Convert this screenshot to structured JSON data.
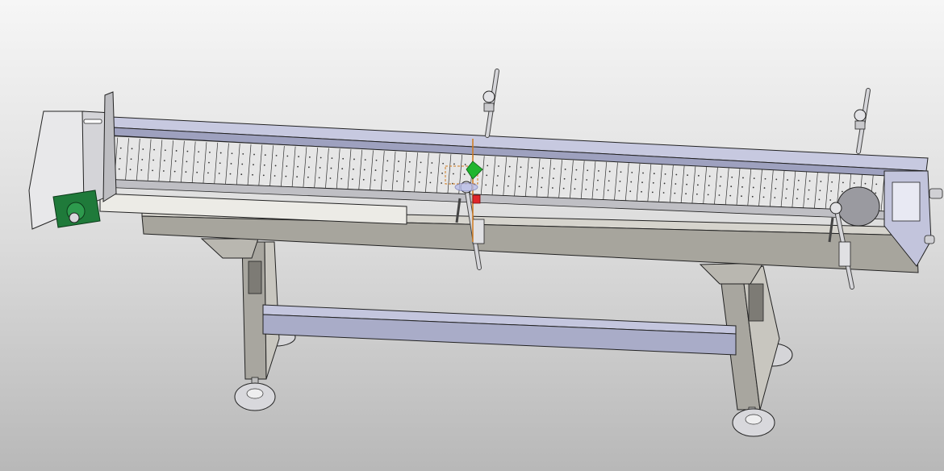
{
  "viewport": {
    "background_top": "#f6f6f6",
    "background_bottom": "#b8b8b8"
  },
  "model": {
    "subject": "belt-conveyor-assembly",
    "colors": {
      "steel": "#c9c9cc",
      "steel_dark": "#7e7d78",
      "frame_blue": "#b9bcd6",
      "frame_blue_dark": "#8c8faa",
      "belt": "#e4e4e4",
      "bearing_green": "#1f7a3a",
      "edge": "#222222"
    },
    "belt_link_count": 70
  },
  "triad": {
    "x_color": "#e0262b",
    "y_color": "#1fb52e",
    "z_color": "#d07a1e",
    "labels": []
  }
}
